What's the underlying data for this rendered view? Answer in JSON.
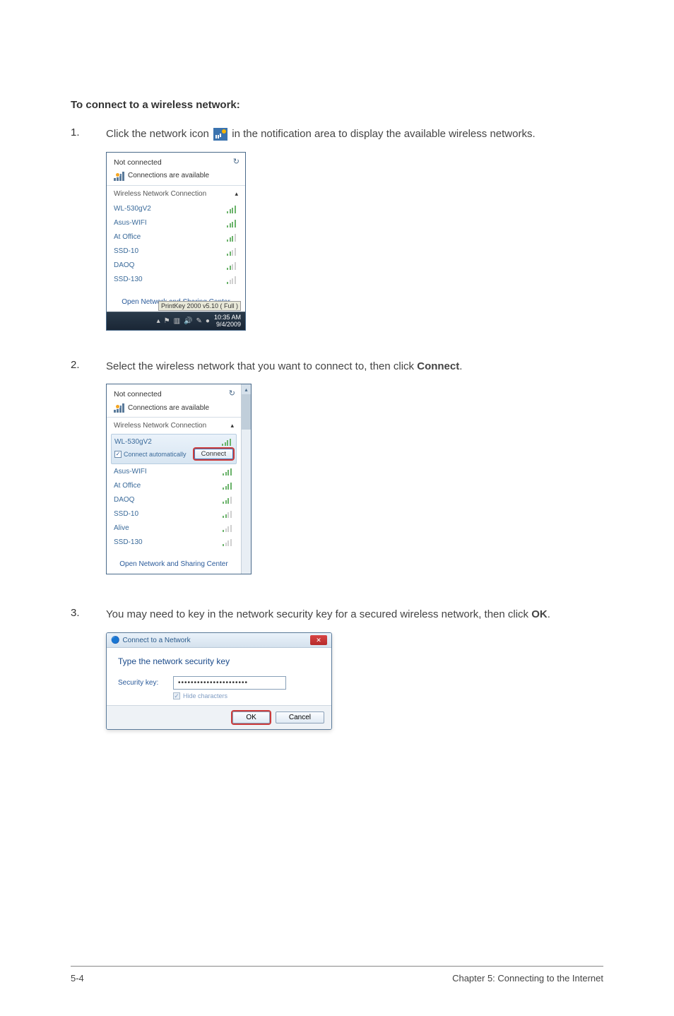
{
  "heading": "To connect to a wireless network:",
  "steps": {
    "s1": {
      "num": "1.",
      "pre": "Click the network icon ",
      "post": " in the notification area to display the available wireless networks."
    },
    "s2": {
      "num": "2.",
      "text_pre": "Select the wireless network that you want to connect to, then click ",
      "bold": "Connect",
      "text_post": "."
    },
    "s3": {
      "num": "3.",
      "text_pre": "You may need to key in the network security key for a secured wireless network, then click ",
      "bold": "OK",
      "text_post": "."
    }
  },
  "popup1": {
    "title": "Not connected",
    "subtitle": "Connections are available",
    "section": "Wireless Network Connection",
    "items": [
      {
        "name": "WL-530gV2",
        "strength": "w4"
      },
      {
        "name": "Asus-WIFI",
        "strength": "w4"
      },
      {
        "name": "At Office",
        "strength": "w3"
      },
      {
        "name": "SSD-10",
        "strength": "w2"
      },
      {
        "name": "DAOQ",
        "strength": "w2"
      },
      {
        "name": "SSD-130",
        "strength": "w1"
      }
    ],
    "footer": "Open Network and Sharing Center",
    "tooltip": "PrintKey 2000 v5.10 ( Full )",
    "time": "10:35 AM",
    "date": "9/4/2009"
  },
  "popup2": {
    "title": "Not connected",
    "subtitle": "Connections are available",
    "section": "Wireless Network Connection",
    "selected": {
      "name": "WL-530gV2",
      "auto": "Connect automatically",
      "connect": "Connect"
    },
    "items": [
      {
        "name": "Asus-WIFI",
        "strength": "w4"
      },
      {
        "name": "At Office",
        "strength": "w4"
      },
      {
        "name": "DAOQ",
        "strength": "w3"
      },
      {
        "name": "SSD-10",
        "strength": "w2"
      },
      {
        "name": "Alive",
        "strength": "w1"
      },
      {
        "name": "SSD-130",
        "strength": "w1"
      }
    ],
    "footer": "Open Network and Sharing Center"
  },
  "dialog": {
    "title": "Connect to a Network",
    "heading": "Type the network security key",
    "label": "Security key:",
    "value": "••••••••••••••••••••••",
    "hide": "Hide characters",
    "ok": "OK",
    "cancel": "Cancel"
  },
  "footer": {
    "left": "5-4",
    "right": "Chapter 5: Connecting to the Internet"
  }
}
